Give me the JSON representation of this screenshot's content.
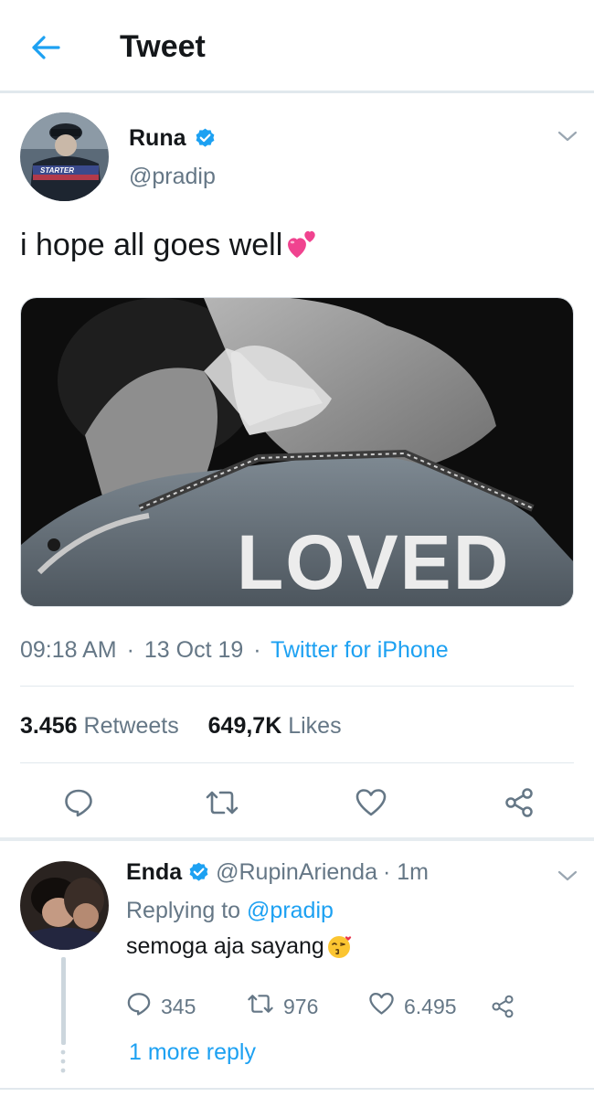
{
  "header": {
    "title": "Tweet"
  },
  "tweet": {
    "author": {
      "name": "Runa",
      "handle": "@pradip",
      "verified": true
    },
    "text": "i hope all goes well",
    "emoji": "two-hearts-icon",
    "media": {
      "overlay_text": "LOVED"
    },
    "meta": {
      "time": "09:18 AM",
      "date": "13 Oct 19",
      "source": "Twitter for iPhone",
      "separator": "·"
    },
    "stats": {
      "retweets_count": "3.456",
      "retweets_label": "Retweets",
      "likes_count": "649,7K",
      "likes_label": "Likes"
    },
    "actions": [
      "comment-icon",
      "retweet-icon",
      "like-icon",
      "share-icon"
    ]
  },
  "reply": {
    "author": {
      "name": "Enda",
      "handle": "@RupinArienda",
      "time": "· 1m",
      "verified": true
    },
    "replying_prefix": "Replying to",
    "replying_to": "@pradip",
    "text": "semoga aja sayang",
    "emoji": "kissing-face-icon",
    "counts": {
      "comments": "345",
      "retweets": "976",
      "likes": "6.495"
    },
    "more_replies": "1 more reply"
  },
  "colors": {
    "accent": "#1da1f2",
    "text_primary": "#14171a",
    "text_secondary": "#657786",
    "divider": "#e1e8ed"
  }
}
